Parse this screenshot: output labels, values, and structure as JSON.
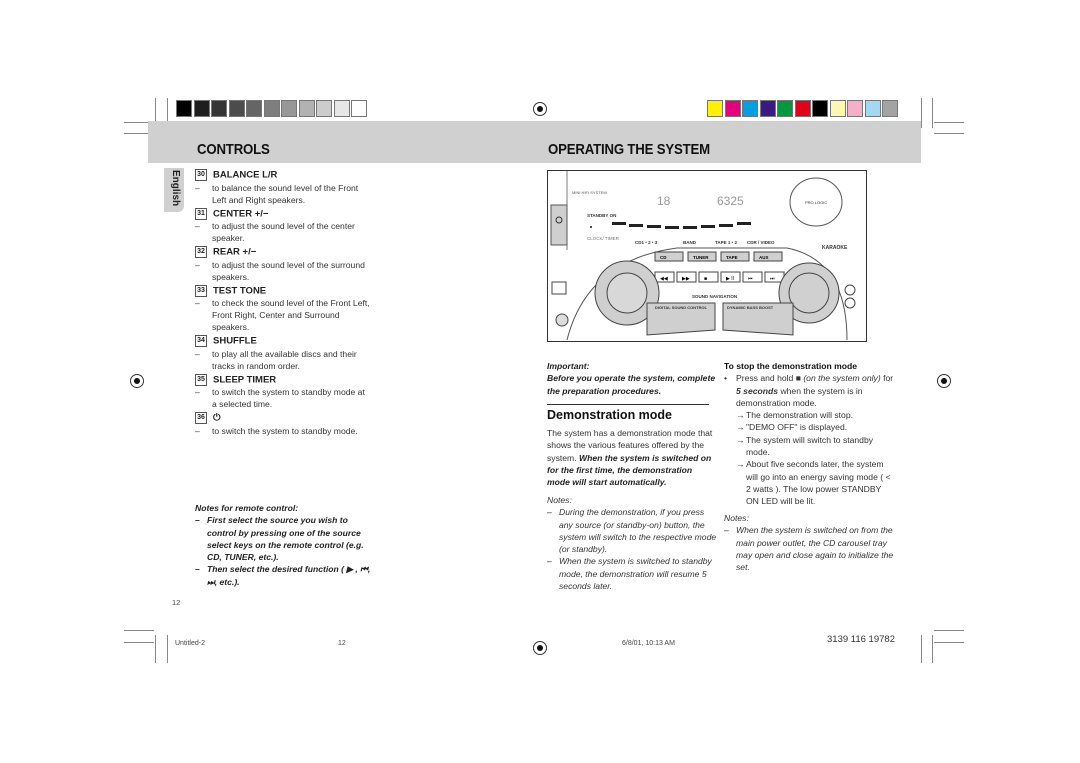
{
  "swatches": {
    "grays": [
      "#000000",
      "#1e1e1e",
      "#353535",
      "#4c4c4c",
      "#656565",
      "#7e7e7e",
      "#989898",
      "#b2b2b2",
      "#cccccc",
      "#e6e6e6",
      "#ffffff"
    ],
    "colors": [
      "#fff200",
      "#e6007e",
      "#00a0e3",
      "#3b1a85",
      "#009a3e",
      "#e3001b",
      "#000000",
      "#fff6b0",
      "#f6afc8",
      "#a0d8f5",
      "#a3a3a3"
    ]
  },
  "left": {
    "header": "CONTROLS",
    "language_tab": "English",
    "controls": [
      {
        "num": "30",
        "title": "BALANCE L/R",
        "desc": "to balance the sound level of the Front Left and Right speakers."
      },
      {
        "num": "31",
        "title": "CENTER +/−",
        "desc": "to adjust the sound level of the center speaker."
      },
      {
        "num": "32",
        "title": "REAR +/−",
        "desc": "to adjust the sound level of the surround speakers."
      },
      {
        "num": "33",
        "title": "TEST TONE",
        "desc": "to check the sound level of the Front Left, Front Right, Center and Surround speakers."
      },
      {
        "num": "34",
        "title": "SHUFFLE",
        "desc": "to play all the available discs and their tracks in random order."
      },
      {
        "num": "35",
        "title": "SLEEP TIMER",
        "desc": "to switch the system to standby mode at a selected time."
      },
      {
        "num": "36",
        "title": "⏻",
        "desc": "to switch the system to standby mode."
      }
    ],
    "remote_notes": {
      "title": "Notes for remote control:",
      "items": [
        "First select the source you wish to control by pressing one of the source select keys on the remote control (e.g.  CD, TUNER, etc.).",
        "Then select the desired function ( ▶ ,  ⏮,  ⏭,  etc.)."
      ]
    },
    "page_number": "12"
  },
  "right": {
    "header": "OPERATING THE SYSTEM",
    "device": {
      "brand_text": "MINI HIFI SYSTEM",
      "standby_label": "STANDBY ON",
      "clock_label": "CLOCK/ TIMER",
      "display_left": "18",
      "display_right": "6325",
      "source_labels": [
        "CD1 • 2 • 3",
        "BAND",
        "TAPE 1 • 2",
        "CDR / VIDEO"
      ],
      "source_buttons": [
        "CD",
        "TUNER",
        "TAPE",
        "AUX"
      ],
      "transport_buttons": [
        "◀◀",
        "▶▶",
        "■",
        "▶ II",
        "⏮",
        "⏭"
      ],
      "sound_nav": "SOUND NAVIGATION",
      "dsc_label": "DIGITAL SOUND CONTROL",
      "dbb_label": "DYNAMIC BASS BOOST",
      "pro_logic": "PRO LOGIC",
      "karaoke": "KARAOKE"
    },
    "important": {
      "title": "Important:",
      "text": "Before you operate the system, complete the preparation procedures."
    },
    "demo": {
      "heading": "Demonstration mode",
      "intro": "The system has a demonstration mode that shows the various features offered by the system.",
      "intro_bold": "When the system is switched on for the first time, the demonstration mode will start automatically.",
      "notes_title": "Notes:",
      "notes": [
        "During the demonstration, if you press any source (or standby-on) button, the system will switch to the respective mode (or standby).",
        "When the system is switched to standby mode, the demonstration will resume 5 seconds later."
      ]
    },
    "stop": {
      "heading": "To stop the demonstration mode",
      "bullet_pre": "Press and hold",
      "bullet_italic": "(on the system only)",
      "bullet_for": "for",
      "bullet_bold": "5 seconds",
      "bullet_post": "when the system is in demonstration mode.",
      "results": [
        "The demonstration will stop.",
        "\"DEMO OFF\" is displayed.",
        "The system will switch to standby mode.",
        "About five seconds later, the system will go into an energy saving mode ( < 2 watts ). The low power STANDBY ON LED will be lit."
      ],
      "notes_title": "Notes:",
      "notes": [
        "When the system is switched on from the main power outlet, the CD carousel tray may open and close again to initialize the set."
      ]
    }
  },
  "footer": {
    "file": "Untitled-2",
    "page": "12",
    "date": "6/8/01, 10:13 AM",
    "code": "3139 116 19782"
  }
}
